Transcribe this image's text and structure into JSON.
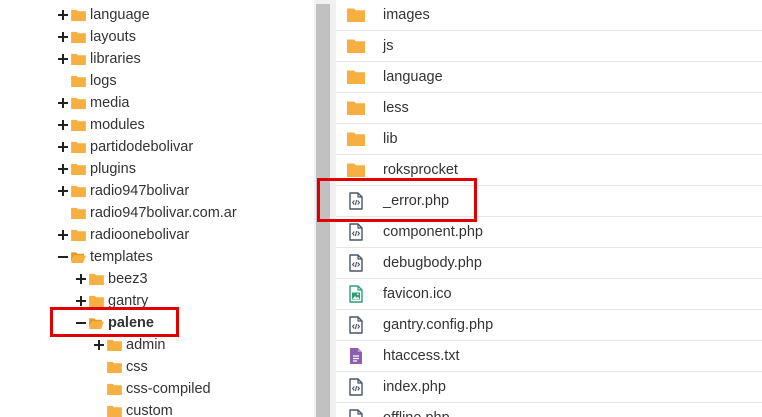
{
  "colors": {
    "folder": "#f5b041",
    "folder_dark": "#e39b23",
    "highlight": "#e00000",
    "php_icon": "#4a5565",
    "image_icon": "#2e9e76",
    "text_icon": "#8e5fb0"
  },
  "tree": {
    "items": [
      {
        "label": "language",
        "toggle": "plus",
        "icon": "folder-icon",
        "depth": 0
      },
      {
        "label": "layouts",
        "toggle": "plus",
        "icon": "folder-icon",
        "depth": 0
      },
      {
        "label": "libraries",
        "toggle": "plus",
        "icon": "folder-icon",
        "depth": 0
      },
      {
        "label": "logs",
        "toggle": "none",
        "icon": "folder-icon",
        "depth": 0
      },
      {
        "label": "media",
        "toggle": "plus",
        "icon": "folder-icon",
        "depth": 0
      },
      {
        "label": "modules",
        "toggle": "plus",
        "icon": "folder-icon",
        "depth": 0
      },
      {
        "label": "partidodebolivar",
        "toggle": "plus",
        "icon": "folder-icon",
        "depth": 0
      },
      {
        "label": "plugins",
        "toggle": "plus",
        "icon": "folder-icon",
        "depth": 0
      },
      {
        "label": "radio947bolivar",
        "toggle": "plus",
        "icon": "folder-icon",
        "depth": 0
      },
      {
        "label": "radio947bolivar.com.ar",
        "toggle": "none",
        "icon": "folder-icon",
        "depth": 0
      },
      {
        "label": "radioonebolivar",
        "toggle": "plus",
        "icon": "folder-icon",
        "depth": 0
      },
      {
        "label": "templates",
        "toggle": "minus",
        "icon": "folder-open-icon",
        "depth": 0
      },
      {
        "label": "beez3",
        "toggle": "plus",
        "icon": "folder-icon",
        "depth": 1
      },
      {
        "label": "gantry",
        "toggle": "plus",
        "icon": "folder-icon",
        "depth": 1
      },
      {
        "label": "palene",
        "toggle": "minus",
        "icon": "folder-open-icon",
        "depth": 1,
        "bold": true,
        "highlighted": true
      },
      {
        "label": "admin",
        "toggle": "plus",
        "icon": "folder-icon",
        "depth": 2
      },
      {
        "label": "css",
        "toggle": "none",
        "icon": "folder-icon",
        "depth": 2
      },
      {
        "label": "css-compiled",
        "toggle": "none",
        "icon": "folder-icon",
        "depth": 2
      },
      {
        "label": "custom",
        "toggle": "none",
        "icon": "folder-icon",
        "depth": 2
      }
    ]
  },
  "files": {
    "items": [
      {
        "name": "images",
        "icon": "folder-icon"
      },
      {
        "name": "js",
        "icon": "folder-icon"
      },
      {
        "name": "language",
        "icon": "folder-icon"
      },
      {
        "name": "less",
        "icon": "folder-icon"
      },
      {
        "name": "lib",
        "icon": "folder-icon"
      },
      {
        "name": "roksprocket",
        "icon": "folder-icon"
      },
      {
        "name": "_error.php",
        "icon": "code-file-icon",
        "highlighted": true
      },
      {
        "name": "component.php",
        "icon": "code-file-icon"
      },
      {
        "name": "debugbody.php",
        "icon": "code-file-icon"
      },
      {
        "name": "favicon.ico",
        "icon": "image-file-icon"
      },
      {
        "name": "gantry.config.php",
        "icon": "code-file-icon"
      },
      {
        "name": "htaccess.txt",
        "icon": "text-file-icon"
      },
      {
        "name": "index.php",
        "icon": "code-file-icon"
      },
      {
        "name": "offline.php",
        "icon": "code-file-icon"
      }
    ]
  }
}
